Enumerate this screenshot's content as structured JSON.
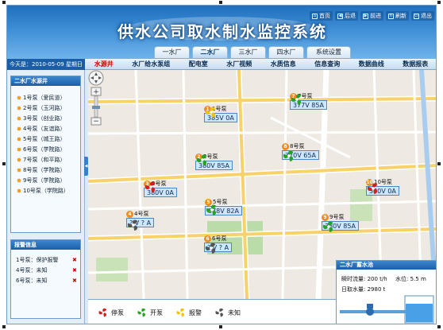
{
  "app": {
    "title": "供水公司取水制水监控系统"
  },
  "toplinks": [
    {
      "label": "首页",
      "icon": "home-icon"
    },
    {
      "label": "后退",
      "icon": "back-icon"
    },
    {
      "label": "前进",
      "icon": "forward-icon"
    },
    {
      "label": "刷新",
      "icon": "refresh-icon"
    },
    {
      "label": "退出",
      "icon": "power-icon"
    }
  ],
  "tabs": [
    {
      "label": "一水厂",
      "active": false
    },
    {
      "label": "二水厂",
      "active": true
    },
    {
      "label": "三水厂",
      "active": false
    },
    {
      "label": "四水厂",
      "active": false
    },
    {
      "label": "系统设置",
      "active": false
    }
  ],
  "date_text": "今天是：2010-05-09 星期日",
  "subnav": [
    {
      "label": "水源井",
      "active": true
    },
    {
      "label": "水厂给水泵组",
      "active": false
    },
    {
      "label": "配电室",
      "active": false
    },
    {
      "label": "水厂视频",
      "active": false
    },
    {
      "label": "水质信息",
      "active": false
    },
    {
      "label": "信息查询",
      "active": false
    },
    {
      "label": "数据曲线",
      "active": false
    },
    {
      "label": "数据报表",
      "active": false
    }
  ],
  "sidebar": {
    "wells_title": "二水厂水源井",
    "wells": [
      "1号泵（爱民道）",
      "2号泵（玉河路）",
      "3号泵（创业路）",
      "4号泵（友谊路）",
      "5号泵（城王路）",
      "6号泵（学院路）",
      "7号泵（和平路）",
      "8号泵（学院路）",
      "9号泵（学院路）",
      "10号泵（学院路）"
    ],
    "alarm_title": "报警信息",
    "alarms": [
      {
        "text": "1号泵：保护报警",
        "mark": "✖"
      },
      {
        "text": "4号泵：未知",
        "mark": "✖"
      },
      {
        "text": "6号泵：未知",
        "mark": "✖"
      }
    ]
  },
  "map": {
    "pumps": [
      {
        "id": "1",
        "label": "1号泵",
        "value": "385V 0A",
        "status": "alarm",
        "status_color": "#f2c300"
      },
      {
        "id": "2",
        "label": "2号泵",
        "value": "380V 85A",
        "status": "run",
        "status_color": "#25a325"
      },
      {
        "id": "3",
        "label": "3号泵",
        "value": "380V 0A",
        "status": "stop",
        "status_color": "#d81d1d"
      },
      {
        "id": "4",
        "label": "4号泵",
        "value": "? V ? A",
        "status": "unknown",
        "status_color": "#555555"
      },
      {
        "id": "5",
        "label": "5号泵",
        "value": "378V 82A",
        "status": "run",
        "status_color": "#25a325"
      },
      {
        "id": "6",
        "label": "6号泵",
        "value": "? V ? A",
        "status": "unknown",
        "status_color": "#555555"
      },
      {
        "id": "7",
        "label": "7号泵",
        "value": "377V 85A",
        "status": "run",
        "status_color": "#25a325"
      },
      {
        "id": "8",
        "label": "8号泵",
        "value": "370V 65A",
        "status": "run",
        "status_color": "#25a325"
      },
      {
        "id": "9",
        "label": "9号泵",
        "value": "380V 85A",
        "status": "run",
        "status_color": "#25a325"
      },
      {
        "id": "10",
        "label": "10号泵",
        "value": "380V 0A",
        "status": "stop",
        "status_color": "#d81d1d"
      }
    ]
  },
  "tank": {
    "title": "二水厂蓄水池",
    "flow_text": "瞬时流量: 200 t/h",
    "level_text": "水位: 5.5 m",
    "daily_text": "日取水量: 2980 t"
  },
  "legend": [
    {
      "label": "停泵",
      "color": "#d81d1d",
      "icon": "fan-stop-icon"
    },
    {
      "label": "开泵",
      "color": "#25a325",
      "icon": "fan-run-icon"
    },
    {
      "label": "报警",
      "color": "#f2c300",
      "icon": "fan-alarm-icon"
    },
    {
      "label": "未知",
      "color": "#555555",
      "icon": "fan-unknown-icon"
    }
  ]
}
